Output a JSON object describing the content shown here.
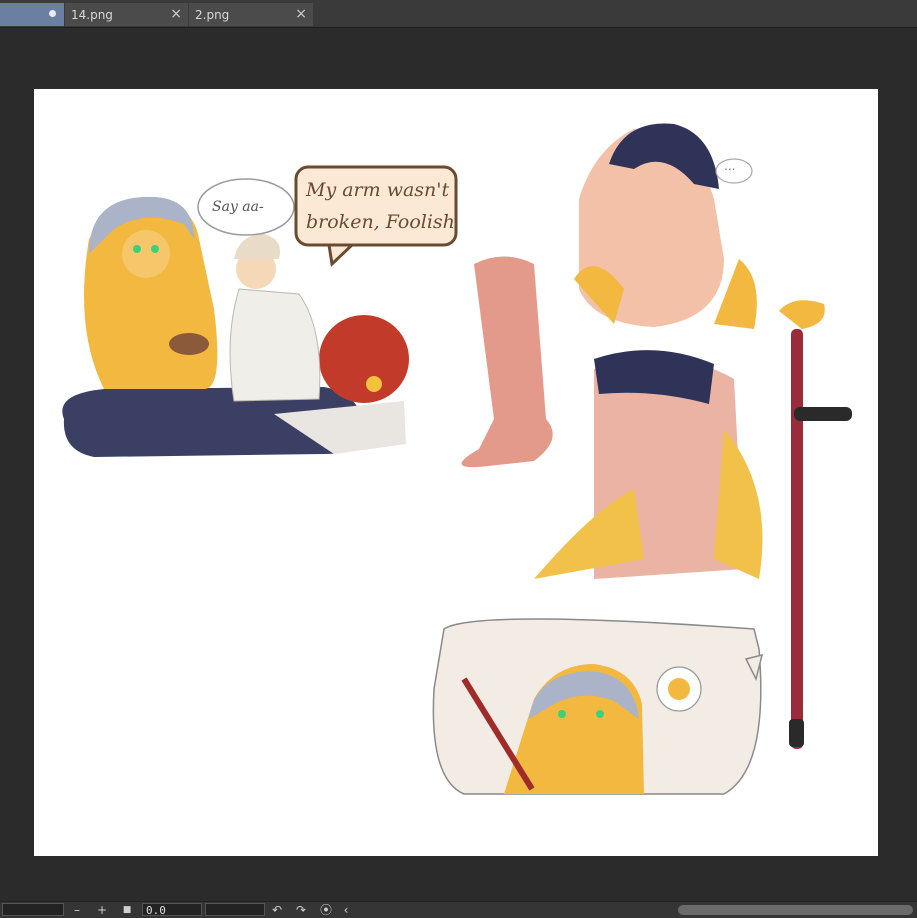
{
  "tabs": [
    {
      "label": "",
      "active": true,
      "modified": true
    },
    {
      "label": "14.png",
      "active": false
    },
    {
      "label": "2.png",
      "active": false
    }
  ],
  "icons": {
    "tab_close": "×",
    "zoom_out": "–",
    "zoom_in": "+",
    "fit_screen": "■",
    "rotate_left": "↶",
    "rotate_right": "↷",
    "reset_rotation": "⦿",
    "collapse": "‹"
  },
  "canvas": {
    "speech_bubble_1": "Say aa-",
    "speech_bubble_2_line1": "My arm wasn't",
    "speech_bubble_2_line2": "broken, Foolish",
    "thought_bubble": "..."
  },
  "statusbar": {
    "rotation_value": "0.0"
  },
  "colors": {
    "tab_active": "#6b7fa3",
    "canvas_bg": "#ffffff",
    "app_bg": "#2b2b2b"
  }
}
